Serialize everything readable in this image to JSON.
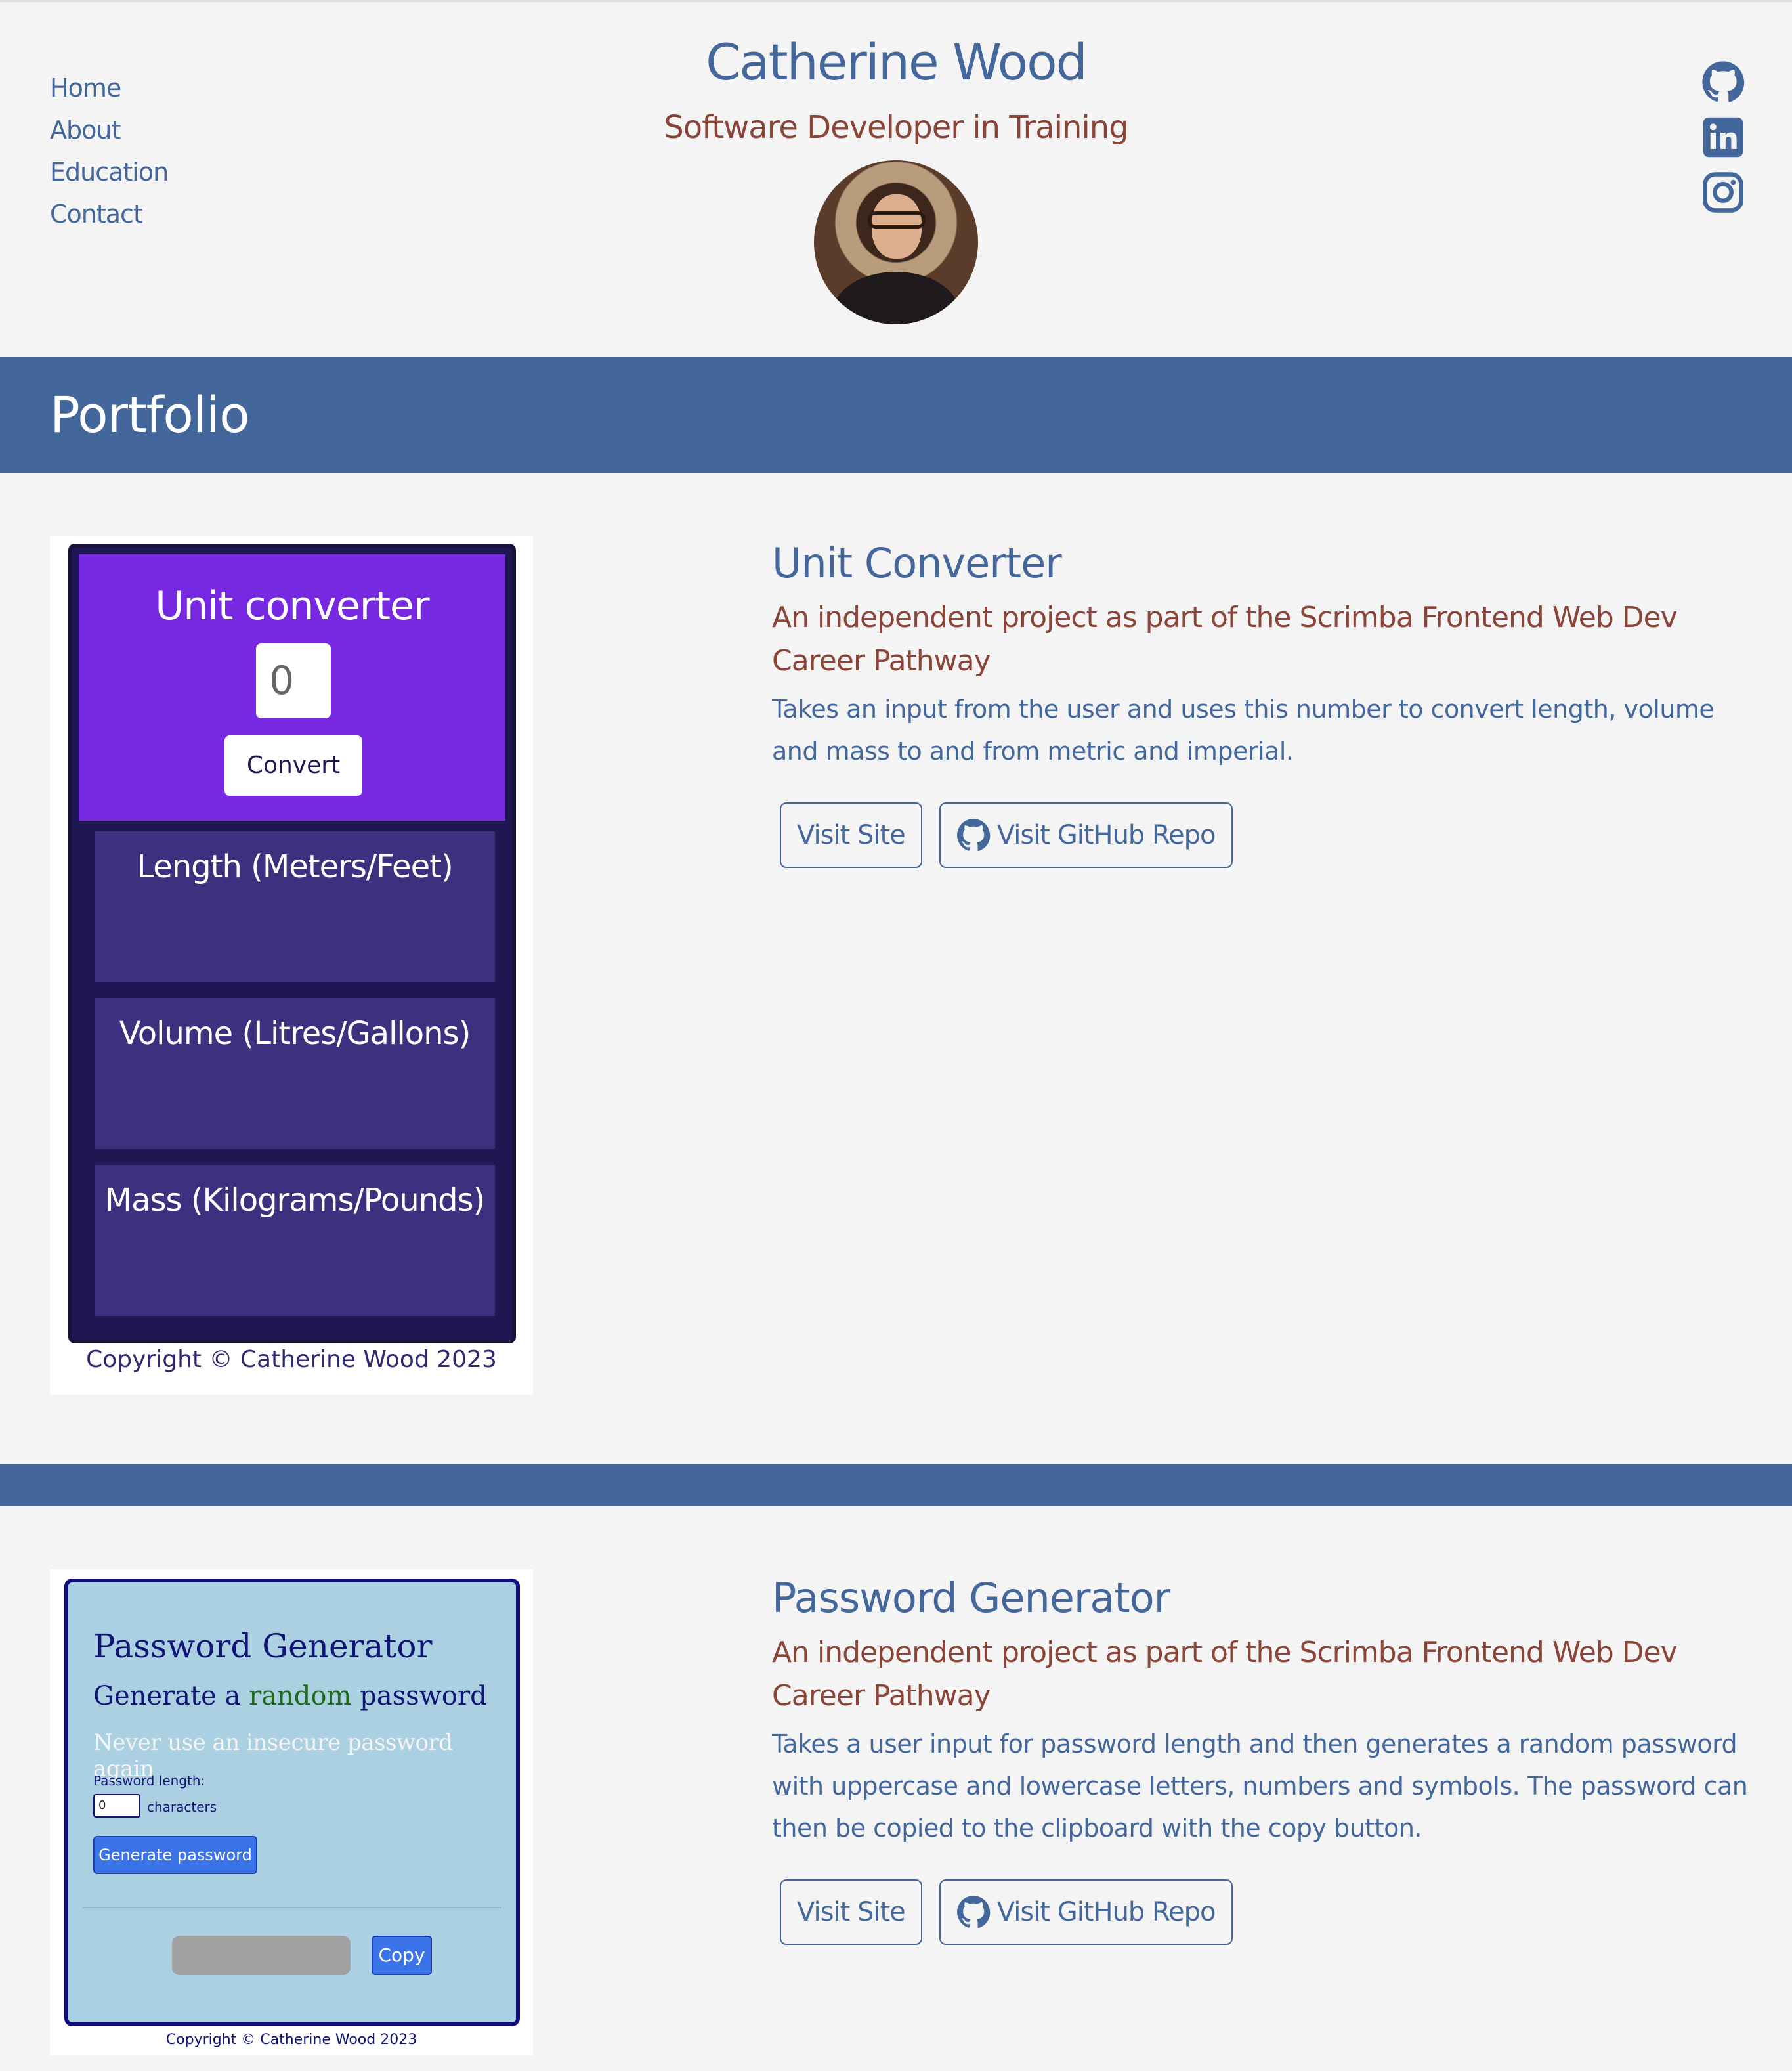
{
  "header": {
    "name": "Catherine Wood",
    "tagline": "Software Developer in Training",
    "nav": [
      "Home",
      "About",
      "Education",
      "Contact"
    ],
    "social": [
      "github-icon",
      "linkedin-icon",
      "instagram-icon"
    ]
  },
  "portfolio": {
    "heading": "Portfolio"
  },
  "projects": [
    {
      "title": "Unit Converter",
      "subtitle": "An independent project as part of the Scrimba Frontend Web Dev Career Pathway",
      "description": "Takes an input from the user and uses this number to convert length, volume and mass to and from metric and imperial.",
      "visit_label": "Visit Site",
      "repo_label": "Visit GitHub Repo",
      "preview": {
        "title": "Unit converter",
        "input_value": "0",
        "button": "Convert",
        "cards": [
          "Length (Meters/Feet)",
          "Volume (Litres/Gallons)",
          "Mass (Kilograms/Pounds)"
        ],
        "copyright": "Copyright © Catherine Wood 2023"
      }
    },
    {
      "title": "Password Generator",
      "subtitle": "An independent project as part of the Scrimba Frontend Web Dev Career Pathway",
      "description": "Takes a user input for password length and then generates a random password with uppercase and lowercase letters, numbers and symbols. The password can then be copied to the clipboard with the copy button.",
      "visit_label": "Visit Site",
      "repo_label": "Visit GitHub Repo",
      "preview": {
        "title": "Password Generator",
        "sub_pre": "Generate a",
        "sub_green": "random",
        "sub_post": "password",
        "never": "Never use an insecure password again",
        "length_label": "Password length:",
        "length_value": "0",
        "chars_label": "characters",
        "generate": "Generate password",
        "copy": "Copy",
        "copyright": "Copyright © Catherine Wood 2023"
      }
    }
  ],
  "colors": {
    "accent": "#44679b",
    "secondary": "#8a4538",
    "background": "#f4f4f4"
  }
}
